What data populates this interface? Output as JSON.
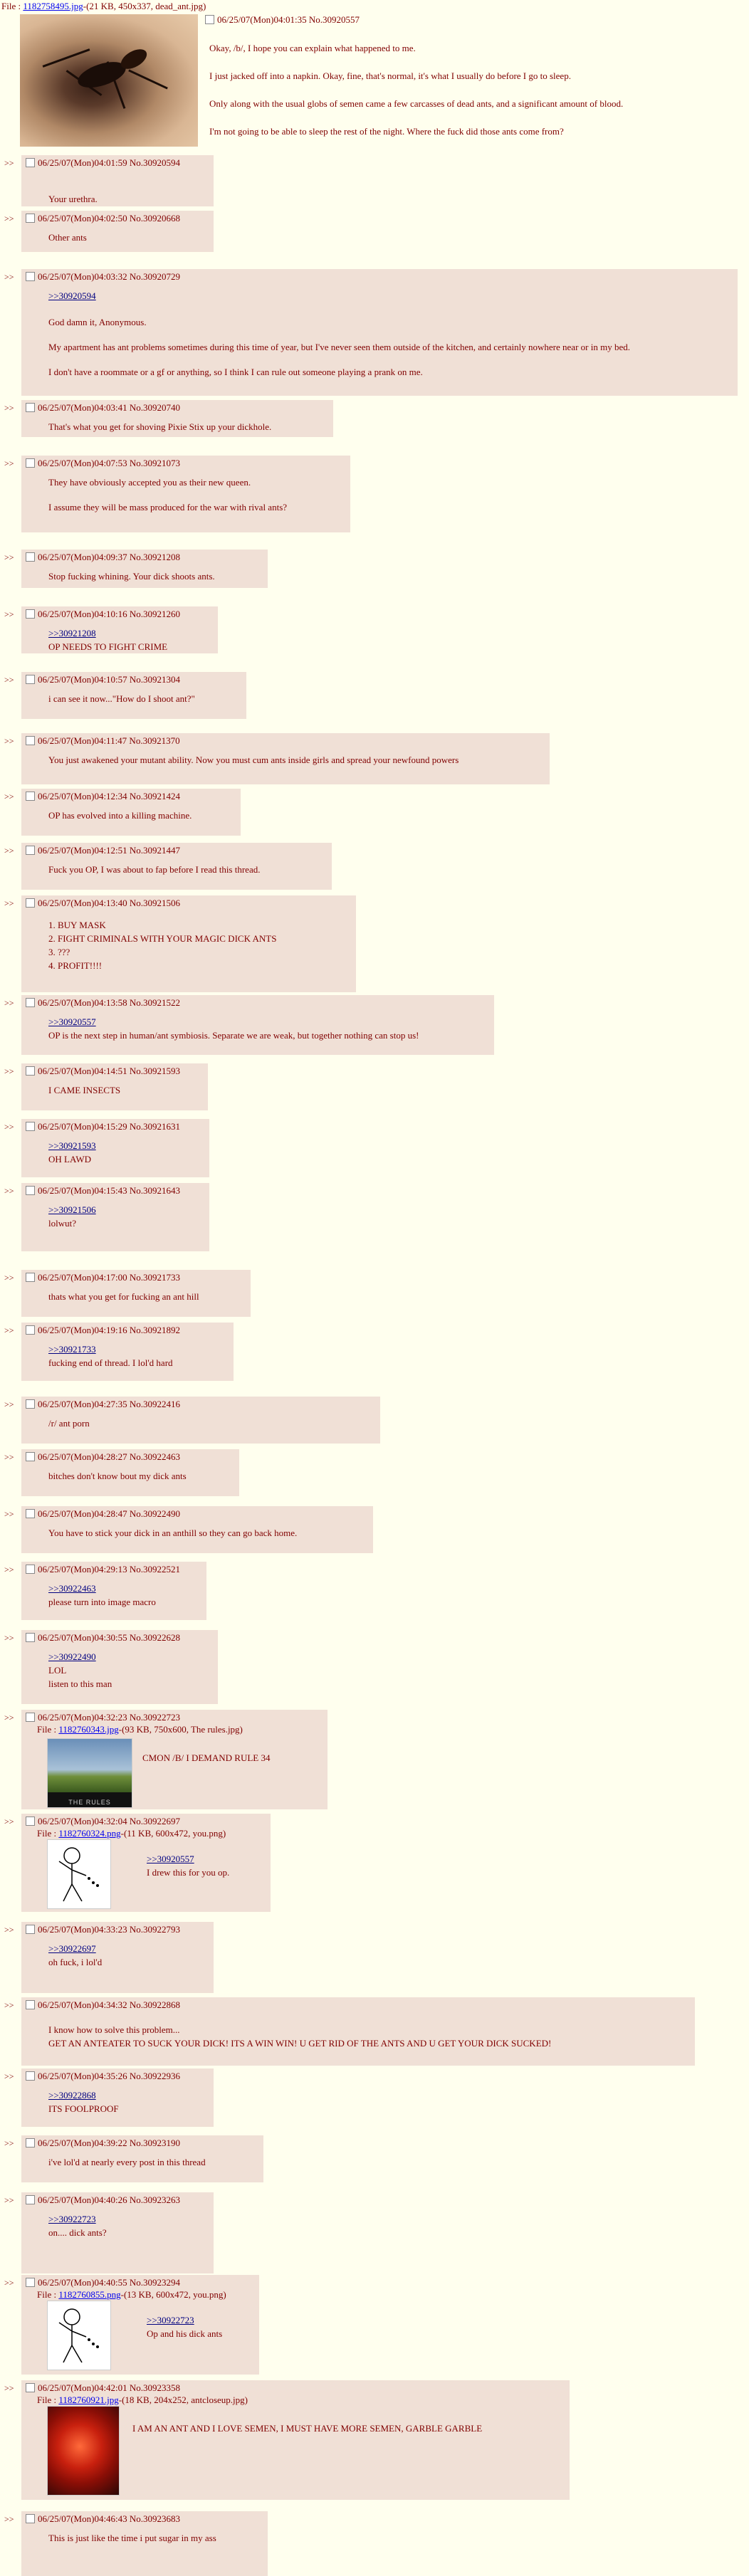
{
  "op": {
    "file_label": "File :",
    "file_name": "1182758495.jpg",
    "file_meta": "-(21 KB, 450x337, dead_ant.jpg)",
    "header": "06/25/07(Mon)04:01:35 No.30920557",
    "paragraphs": [
      "Okay, /b/, I hope you can explain what happened to me.",
      "I just jacked off into a napkin. Okay, fine, that's normal, it's what I usually do before I go to sleep.",
      "Only along with the usual globs of semen came a few carcasses of dead ants, and a significant amount of blood.",
      "I'm not going to be able to sleep the rest of the night. Where the fuck did those ants come from?"
    ]
  },
  "replies": [
    {
      "header": "06/25/07(Mon)04:01:59 No.30920594",
      "lines": [
        "Your urethra."
      ]
    },
    {
      "header": "06/25/07(Mon)04:02:50 No.30920668",
      "lines": [
        "Other ants"
      ]
    },
    {
      "header": "06/25/07(Mon)04:03:32 No.30920729",
      "quote": ">>30920594",
      "lines": [
        "God damn it, Anonymous.",
        "My apartment has ant problems sometimes during this time of year, but I've never seen them outside of the kitchen, and certainly nowhere near or in my bed.",
        "I don't have a roommate or a gf or anything, so I think I can rule out someone playing a prank on me."
      ]
    },
    {
      "header": "06/25/07(Mon)04:03:41 No.30920740",
      "lines": [
        "That's what you get for shoving Pixie Stix up your dickhole."
      ]
    },
    {
      "header": "06/25/07(Mon)04:07:53 No.30921073",
      "lines": [
        "They have obviously accepted you as their new queen.",
        "I assume they will be mass produced for the war with rival ants?"
      ]
    },
    {
      "header": "06/25/07(Mon)04:09:37 No.30921208",
      "lines": [
        "Stop fucking whining. Your dick shoots ants."
      ]
    },
    {
      "header": "06/25/07(Mon)04:10:16 No.30921260",
      "quote": ">>30921208",
      "lines": [
        "OP NEEDS TO FIGHT CRIME"
      ]
    },
    {
      "header": "06/25/07(Mon)04:10:57 No.30921304",
      "lines": [
        "i can see it now...\"How do I shoot ant?\""
      ]
    },
    {
      "header": "06/25/07(Mon)04:11:47 No.30921370",
      "lines": [
        "You just awakened your mutant ability. Now you must cum ants inside girls and spread your newfound powers"
      ]
    },
    {
      "header": "06/25/07(Mon)04:12:34 No.30921424",
      "lines": [
        "OP has evolved into a killing machine."
      ]
    },
    {
      "header": "06/25/07(Mon)04:12:51 No.30921447",
      "lines": [
        "Fuck you OP, I was about to fap before I read this thread."
      ]
    },
    {
      "header": "06/25/07(Mon)04:13:40 No.30921506",
      "lines": [
        "1. BUY MASK",
        "2. FIGHT CRIMINALS WITH YOUR MAGIC DICK ANTS",
        "3. ???",
        "4. PROFIT!!!!"
      ]
    },
    {
      "header": "06/25/07(Mon)04:13:58 No.30921522",
      "quote": ">>30920557",
      "lines": [
        "OP is the next step in human/ant symbiosis. Separate we are weak, but together nothing can stop us!"
      ]
    },
    {
      "header": "06/25/07(Mon)04:14:51 No.30921593",
      "lines": [
        "I CAME INSECTS"
      ]
    },
    {
      "header": "06/25/07(Mon)04:15:29 No.30921631",
      "quote": ">>30921593",
      "lines": [
        "OH LAWD"
      ]
    },
    {
      "header": "06/25/07(Mon)04:15:43 No.30921643",
      "quote": ">>30921506",
      "lines": [
        "lolwut?"
      ]
    },
    {
      "header": "06/25/07(Mon)04:17:00 No.30921733",
      "lines": [
        "thats what you get for fucking an ant hill"
      ]
    },
    {
      "header": "06/25/07(Mon)04:19:16 No.30921892",
      "quote": ">>30921733",
      "lines": [
        "fucking end of thread. I lol'd hard"
      ]
    },
    {
      "header": "06/25/07(Mon)04:27:35 No.30922416",
      "lines": [
        "/r/ ant porn"
      ]
    },
    {
      "header": "06/25/07(Mon)04:28:27 No.30922463",
      "lines": [
        "bitches don't know bout my dick ants"
      ]
    },
    {
      "header": "06/25/07(Mon)04:28:47 No.30922490",
      "lines": [
        "You have to stick your dick in an anthill so they can go back home."
      ]
    },
    {
      "header": "06/25/07(Mon)04:29:13 No.30922521",
      "quote": ">>30922463",
      "lines": [
        "please turn into image macro"
      ]
    },
    {
      "header": "06/25/07(Mon)04:30:55 No.30922628",
      "quote": ">>30922490",
      "lines": [
        "LOL",
        "listen to this man"
      ]
    },
    {
      "header": "06/25/07(Mon)04:32:23 No.30922723",
      "file_name": "1182760343.jpg",
      "file_meta": "-(93 KB, 750x600, The rules.jpg)",
      "lines": [
        "CMON /B/ I DEMAND RULE 34"
      ]
    },
    {
      "header": "06/25/07(Mon)04:32:04 No.30922697",
      "file_name": "1182760324.png",
      "file_meta": "-(11 KB, 600x472, you.png)",
      "quote": ">>30920557",
      "lines": [
        "I drew this for you op."
      ]
    },
    {
      "header": "06/25/07(Mon)04:33:23 No.30922793",
      "quote": ">>30922697",
      "lines": [
        "oh fuck, i lol'd"
      ]
    },
    {
      "header": "06/25/07(Mon)04:34:32 No.30922868",
      "lines": [
        "I know how to solve this problem...",
        "GET AN ANTEATER TO SUCK YOUR DICK! ITS A WIN WIN! U GET RID OF THE ANTS AND U GET YOUR DICK SUCKED!"
      ]
    },
    {
      "header": "06/25/07(Mon)04:35:26 No.30922936",
      "quote": ">>30922868",
      "lines": [
        "ITS FOOLPROOF"
      ]
    },
    {
      "header": "06/25/07(Mon)04:39:22 No.30923190",
      "lines": [
        "i've lol'd at nearly every post in this thread"
      ]
    },
    {
      "header": "06/25/07(Mon)04:40:26 No.30923263",
      "quote": ">>30922723",
      "lines": [
        "on.... dick ants?"
      ]
    },
    {
      "header": "06/25/07(Mon)04:40:55 No.30923294",
      "file_name": "1182760855.png",
      "file_meta": "-(13 KB, 600x472, you.png)",
      "quote": ">>30922723",
      "lines": [
        "Op and his dick ants"
      ]
    },
    {
      "header": "06/25/07(Mon)04:42:01 No.30923358",
      "file_name": "1182760921.jpg",
      "file_meta": "-(18 KB, 204x252, antcloseup.jpg)",
      "lines": [
        "I AM AN ANT AND I LOVE SEMEN, I MUST HAVE MORE SEMEN, GARBLE GARBLE"
      ]
    },
    {
      "header": "06/25/07(Mon)04:46:43 No.30923683",
      "lines": [
        "This is just like the time i put sugar in my ass"
      ]
    }
  ],
  "labels": {
    "arrows": ">>",
    "file_label": "File :",
    "macro_caption": "THE RULES"
  },
  "colors": {
    "page_bg": "#ffffee",
    "reply_bg": "#f0e0d6",
    "text": "#800000",
    "quote_link": "#000080",
    "file_link": "#0000ee"
  }
}
